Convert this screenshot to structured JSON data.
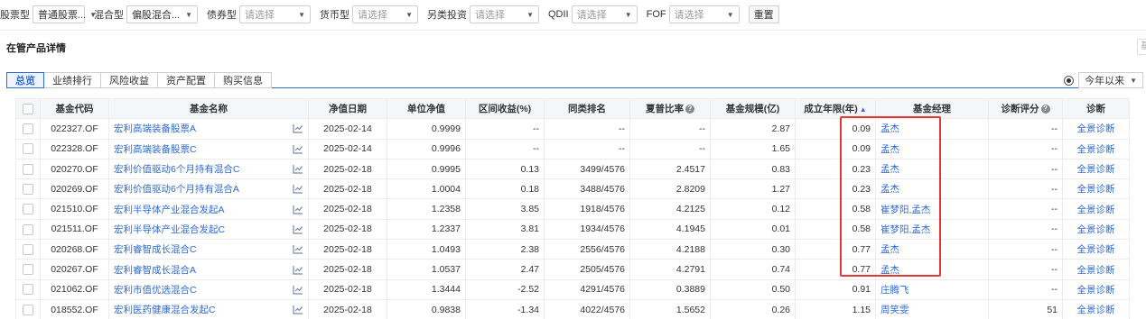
{
  "filters": [
    {
      "label": "股票型",
      "value": "普通股票...",
      "placeholder": false
    },
    {
      "label": "混合型",
      "value": "偏股混合...",
      "placeholder": false
    },
    {
      "label": "债券型",
      "value": "请选择",
      "placeholder": true
    },
    {
      "label": "货币型",
      "value": "请选择",
      "placeholder": true
    },
    {
      "label": "另类投资",
      "value": "请选择",
      "placeholder": true
    },
    {
      "label": "QDII",
      "value": "请选择",
      "placeholder": true
    },
    {
      "label": "FOF",
      "value": "请选择",
      "placeholder": true
    }
  ],
  "reset_label": "重置",
  "section_title": "在管产品详情",
  "right_edge_text": "基",
  "tabs": [
    "总览",
    "业绩排行",
    "风险收益",
    "资产配置",
    "购买信息"
  ],
  "active_tab": 0,
  "period": {
    "value": "今年以来"
  },
  "table": {
    "headers": {
      "code": "基金代码",
      "name": "基金名称",
      "date": "净值日期",
      "nav": "单位净值",
      "return": "区间收益(%)",
      "rank": "同类排名",
      "sharpe": "夏普比率",
      "scale": "基金规模(亿)",
      "years": "成立年限(年)",
      "manager": "基金经理",
      "score": "诊断评分",
      "diag": "诊断"
    },
    "rows": [
      {
        "code": "022327.OF",
        "name": "宏利高端装备股票A",
        "date": "2025-02-14",
        "nav": "0.9999",
        "return": "--",
        "rank": "--",
        "sharpe": "--",
        "scale": "2.87",
        "years": "0.09",
        "manager": "孟杰",
        "score": "--",
        "diag": "全景诊断"
      },
      {
        "code": "022328.OF",
        "name": "宏利高端装备股票C",
        "date": "2025-02-14",
        "nav": "0.9996",
        "return": "--",
        "rank": "--",
        "sharpe": "--",
        "scale": "1.65",
        "years": "0.09",
        "manager": "孟杰",
        "score": "--",
        "diag": "全景诊断"
      },
      {
        "code": "020270.OF",
        "name": "宏利价值驱动6个月持有混合C",
        "date": "2025-02-18",
        "nav": "0.9995",
        "return": "0.13",
        "rank": "3499/4576",
        "sharpe": "2.4517",
        "scale": "0.83",
        "years": "0.23",
        "manager": "孟杰",
        "score": "--",
        "diag": "全景诊断"
      },
      {
        "code": "020269.OF",
        "name": "宏利价值驱动6个月持有混合A",
        "date": "2025-02-18",
        "nav": "1.0004",
        "return": "0.18",
        "rank": "3488/4576",
        "sharpe": "2.8209",
        "scale": "1.27",
        "years": "0.23",
        "manager": "孟杰",
        "score": "--",
        "diag": "全景诊断"
      },
      {
        "code": "021510.OF",
        "name": "宏利半导体产业混合发起A",
        "date": "2025-02-18",
        "nav": "1.2358",
        "return": "3.85",
        "rank": "1918/4576",
        "sharpe": "4.2125",
        "scale": "0.12",
        "years": "0.58",
        "manager": "崔梦阳,孟杰",
        "score": "--",
        "diag": "全景诊断"
      },
      {
        "code": "021511.OF",
        "name": "宏利半导体产业混合发起C",
        "date": "2025-02-18",
        "nav": "1.2337",
        "return": "3.81",
        "rank": "1934/4576",
        "sharpe": "4.1945",
        "scale": "0.01",
        "years": "0.58",
        "manager": "崔梦阳,孟杰",
        "score": "--",
        "diag": "全景诊断"
      },
      {
        "code": "020268.OF",
        "name": "宏利睿智成长混合C",
        "date": "2025-02-18",
        "nav": "1.0493",
        "return": "2.38",
        "rank": "2556/4576",
        "sharpe": "4.2188",
        "scale": "0.30",
        "years": "0.77",
        "manager": "孟杰",
        "score": "--",
        "diag": "全景诊断"
      },
      {
        "code": "020267.OF",
        "name": "宏利睿智成长混合A",
        "date": "2025-02-18",
        "nav": "1.0537",
        "return": "2.47",
        "rank": "2505/4576",
        "sharpe": "4.2791",
        "scale": "0.74",
        "years": "0.77",
        "manager": "孟杰",
        "score": "--",
        "diag": "全景诊断"
      },
      {
        "code": "021062.OF",
        "name": "宏利市值优选混合C",
        "date": "2025-02-18",
        "nav": "1.3444",
        "return": "-2.52",
        "rank": "4291/4576",
        "sharpe": "0.3889",
        "scale": "0.50",
        "years": "0.91",
        "manager": "庄腾飞",
        "score": "--",
        "diag": "全景诊断"
      },
      {
        "code": "018552.OF",
        "name": "宏利医药健康混合发起C",
        "date": "2025-02-18",
        "nav": "0.9838",
        "return": "-1.34",
        "rank": "4022/4576",
        "sharpe": "1.5652",
        "scale": "0.26",
        "years": "1.15",
        "manager": "周笑雯",
        "score": "51",
        "diag": "全景诊断"
      }
    ]
  },
  "colors": {
    "accent": "#2f6bd1",
    "highlight": "#e53935",
    "header_bg": "#f5f6f8"
  },
  "icons": {
    "row_chart": "chart-icon",
    "help": "help-icon",
    "sort": "sort-up-icon"
  }
}
